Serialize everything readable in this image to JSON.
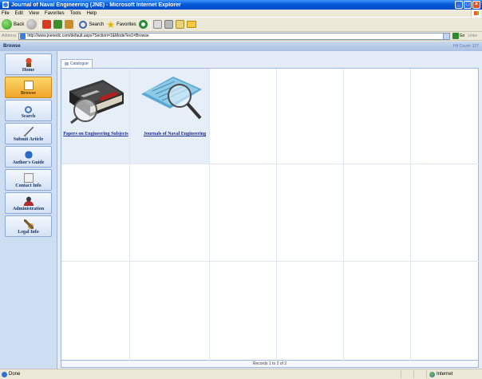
{
  "window": {
    "title": "Journal of Naval Engineering (JNE) - Microsoft Internet Explorer",
    "buttons": {
      "minimize": "_",
      "maximize": "□",
      "close": "×"
    }
  },
  "menu": [
    "File",
    "Edit",
    "View",
    "Favorites",
    "Tools",
    "Help"
  ],
  "toolbar": {
    "back_label": "Back",
    "search_label": "Search",
    "favorites_label": "Favorites"
  },
  "address": {
    "label": "Address",
    "url": "http://www.jnenedc.com/default.aspx?Section=1&ModeTex1=Browse",
    "go_label": "Go",
    "links_label": "Links"
  },
  "page": {
    "section_title": "Browse",
    "hit_count": "Hit Count: 127"
  },
  "sidebar": {
    "items": [
      {
        "label": "Home",
        "icon": "home-icon",
        "active": false
      },
      {
        "label": "Browse",
        "icon": "browse-icon",
        "active": true
      },
      {
        "label": "Search",
        "icon": "search-icon",
        "active": false
      },
      {
        "label": "Submit Article",
        "icon": "submit-icon",
        "active": false
      },
      {
        "label": "Author's Guide",
        "icon": "guide-icon",
        "active": false
      },
      {
        "label": "Contact Info",
        "icon": "contact-icon",
        "active": false
      },
      {
        "label": "Administration",
        "icon": "admin-icon",
        "active": false
      },
      {
        "label": "Legal Info",
        "icon": "legal-icon",
        "active": false
      }
    ]
  },
  "catalogue": {
    "tab_label": "Catalogue",
    "items": [
      {
        "title": "Papers on Engineering Subjects",
        "icon": "book-magnifier-icon"
      },
      {
        "title": "Journals of Naval Engineering",
        "icon": "papers-magnifier-icon"
      }
    ],
    "records_text": "Records 1 to 2 of 2"
  },
  "status": {
    "text": "Done",
    "zone": "Internet"
  }
}
